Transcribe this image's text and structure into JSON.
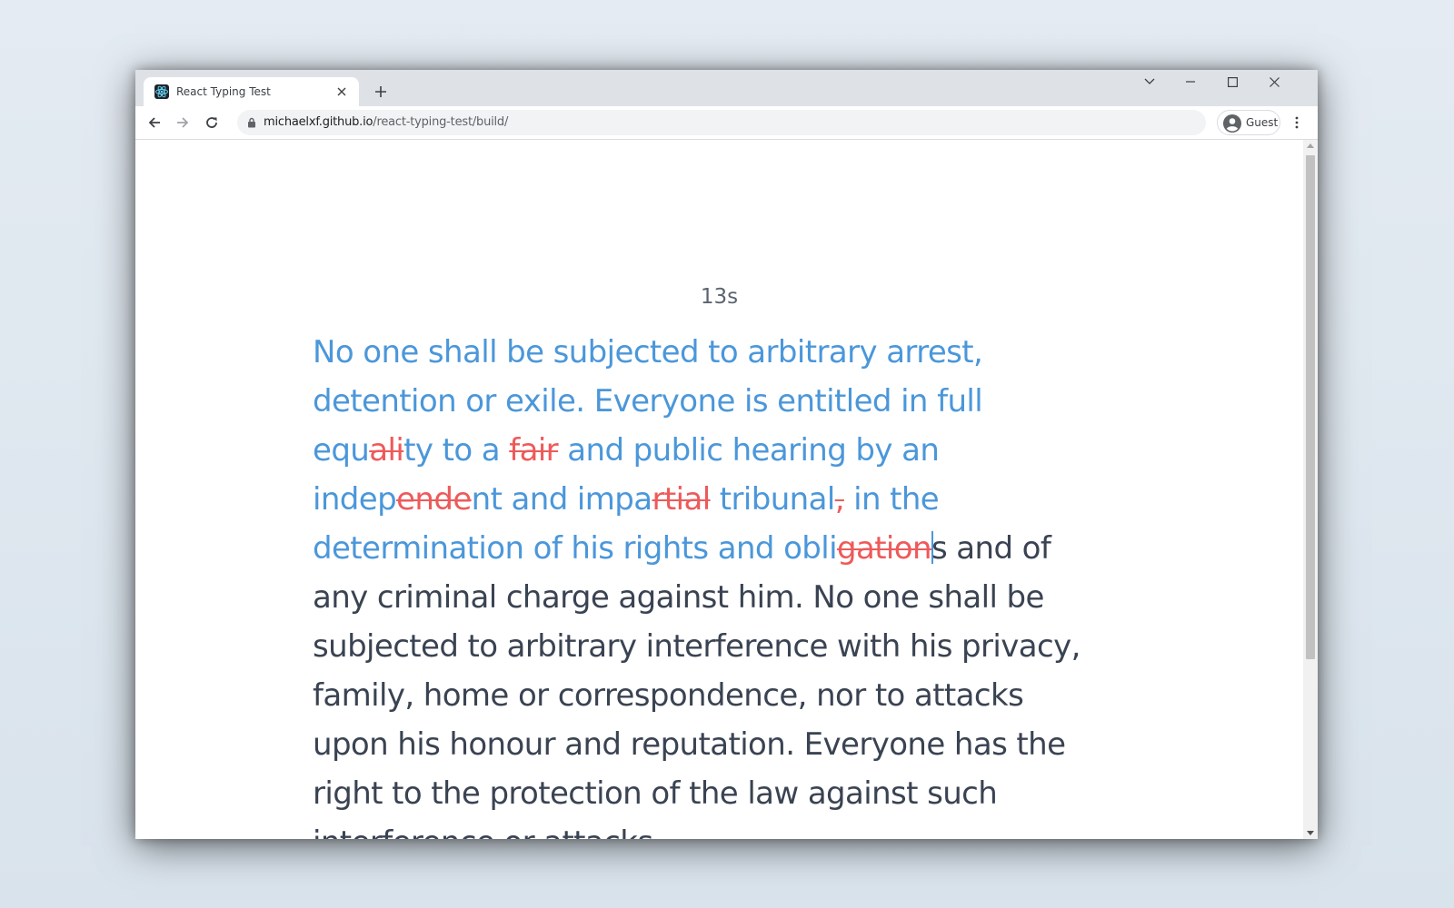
{
  "browser": {
    "tab_title": "React Typing Test",
    "url_host": "michaelxf.github.io",
    "url_path": "/react-typing-test/build/",
    "profile_label": "Guest"
  },
  "app": {
    "timer": "13s",
    "lines": [
      [
        {
          "t": "No one shall be subjected to arbitrary arrest,",
          "s": "ok"
        }
      ],
      [
        {
          "t": "detention or exile. Everyone is entitled in full",
          "s": "ok"
        }
      ],
      [
        {
          "t": "equ",
          "s": "ok"
        },
        {
          "t": "ali",
          "s": "bad"
        },
        {
          "t": "ty to a ",
          "s": "ok"
        },
        {
          "t": "fair",
          "s": "bad"
        },
        {
          "t": " and public hearing by an",
          "s": "ok"
        }
      ],
      [
        {
          "t": "indep",
          "s": "ok"
        },
        {
          "t": "ende",
          "s": "bad"
        },
        {
          "t": "nt and impa",
          "s": "ok"
        },
        {
          "t": "rtial",
          "s": "bad"
        },
        {
          "t": " tribunal",
          "s": "ok"
        },
        {
          "t": ",",
          "s": "bad"
        },
        {
          "t": " in the",
          "s": "ok"
        }
      ],
      [
        {
          "t": "determination of his rights and obli",
          "s": "ok"
        },
        {
          "t": "gation",
          "s": "bad"
        },
        {
          "t": "",
          "s": "cursor"
        },
        {
          "t": "s and of",
          "s": "todo"
        }
      ],
      [
        {
          "t": "any criminal charge against him. No one shall be",
          "s": "todo"
        }
      ],
      [
        {
          "t": "subjected to arbitrary interference with his privacy,",
          "s": "todo"
        }
      ],
      [
        {
          "t": "family, home or correspondence, nor to attacks",
          "s": "todo"
        }
      ],
      [
        {
          "t": "upon his honour and reputation. Everyone has the",
          "s": "todo"
        }
      ],
      [
        {
          "t": "right to the protection of the law against such",
          "s": "todo"
        }
      ],
      [
        {
          "t": "interference or attacks.",
          "s": "todo"
        }
      ]
    ]
  },
  "colors": {
    "typed_correct": "#4b97da",
    "typed_error": "#ee5a5a",
    "untyped": "#3a4352",
    "timer": "#5a6470"
  }
}
